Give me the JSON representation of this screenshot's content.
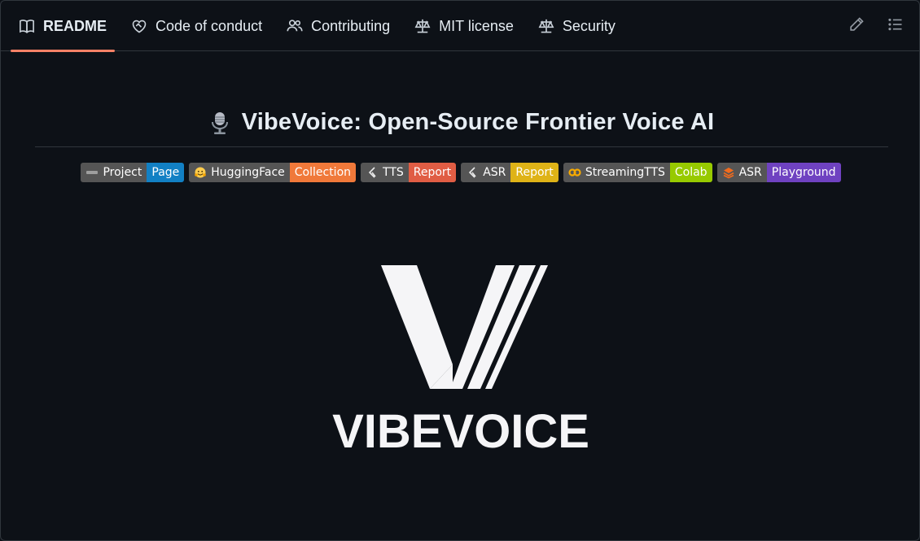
{
  "tabs": [
    {
      "label": "README",
      "icon": "book-icon",
      "active": true
    },
    {
      "label": "Code of conduct",
      "icon": "heart-handshake-icon",
      "active": false
    },
    {
      "label": "Contributing",
      "icon": "people-icon",
      "active": false
    },
    {
      "label": "MIT license",
      "icon": "law-icon",
      "active": false
    },
    {
      "label": "Security",
      "icon": "law-icon",
      "active": false
    }
  ],
  "toolbar": {
    "edit_icon": "pencil-icon",
    "outline_icon": "list-unordered-icon"
  },
  "heading": {
    "emoji": "studio-microphone-icon",
    "title": "VibeVoice: Open-Source Frontier Voice AI"
  },
  "badges": [
    {
      "label": "Project",
      "message": "Page",
      "color": "#1280c4",
      "icon": "project-logo-icon"
    },
    {
      "label": "HuggingFace",
      "message": "Collection",
      "color": "#f0793a",
      "icon": "hugging-face-icon"
    },
    {
      "label": "TTS",
      "message": "Report",
      "color": "#e05d44",
      "icon": "arxiv-icon"
    },
    {
      "label": "ASR",
      "message": "Report",
      "color": "#dfb317",
      "icon": "arxiv-icon"
    },
    {
      "label": "StreamingTTS",
      "message": "Colab",
      "color": "#97ca00",
      "icon": "colab-icon"
    },
    {
      "label": "ASR",
      "message": "Playground",
      "color": "#6f42c1",
      "icon": "stack-icon"
    }
  ],
  "logo": {
    "wordmark": "VIBEVOICE"
  },
  "colors": {
    "background": "#0d1117",
    "border": "#30363d",
    "active_tab": "#f78166",
    "text": "#e6edf3"
  }
}
